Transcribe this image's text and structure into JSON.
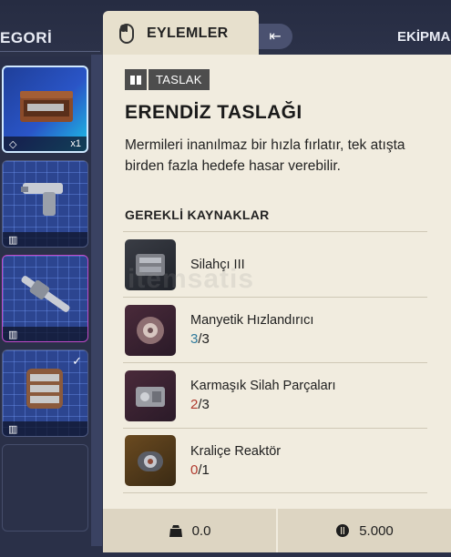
{
  "background": {
    "category_label": "EGORİ",
    "equipment_label": "EKİPMA",
    "slots": [
      {
        "badge": "x1",
        "selected": true
      },
      {
        "badge": ""
      },
      {
        "badge": ""
      },
      {
        "badge": "",
        "checked": true
      },
      {
        "badge": ""
      }
    ]
  },
  "tooltip": {
    "actions_label": "EYLEMLER",
    "tag_label": "TASLAK",
    "title": "ERENDİZ TASLAĞI",
    "description": "Mermileri inanılmaz bir hızla fırlatır, tek atışta birden fazla hedefe hasar verebilir.",
    "requirements_title": "GEREKLİ KAYNAKLAR",
    "requirements": [
      {
        "name": "Silahçı III",
        "have": "",
        "sep": "",
        "need": "",
        "status": "none"
      },
      {
        "name": "Manyetik Hızlandırıcı",
        "have": "3",
        "sep": "/",
        "need": "3",
        "status": "ok"
      },
      {
        "name": "Karmaşık Silah Parçaları",
        "have": "2",
        "sep": "/",
        "need": "3",
        "status": "low"
      },
      {
        "name": "Kraliçe Reaktör",
        "have": "0",
        "sep": "/",
        "need": "1",
        "status": "low"
      }
    ],
    "footer": {
      "weight": "0.0",
      "price": "5.000"
    }
  },
  "watermark": "itemsatis"
}
